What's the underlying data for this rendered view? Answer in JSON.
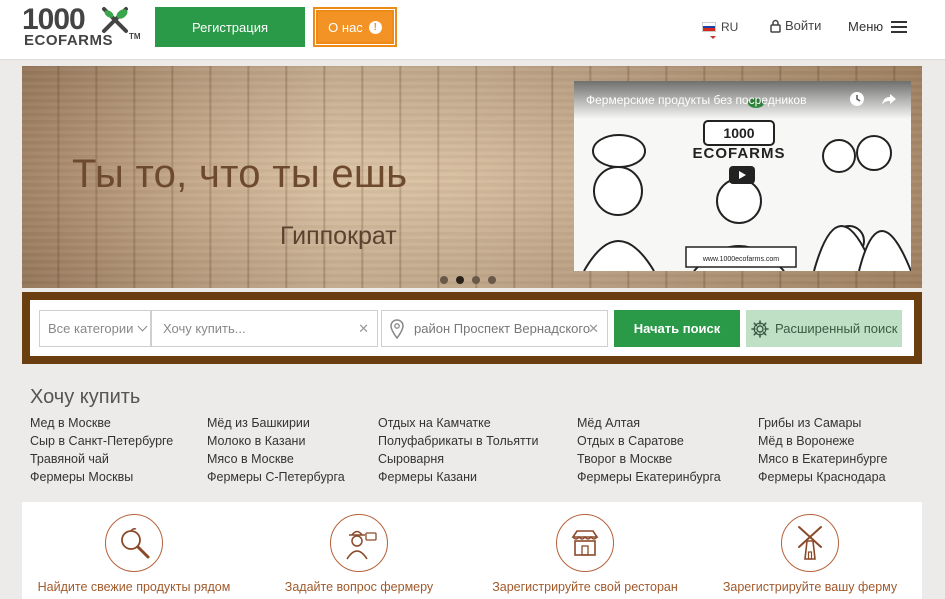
{
  "header": {
    "logo_num": "1000",
    "logo_text": "ECOFARMS",
    "logo_tm": "TM",
    "register_label": "Регистрация",
    "about_label": "О нас",
    "lang": "RU",
    "login_label": "Войти",
    "menu_label": "Меню"
  },
  "hero": {
    "quote": "Ты то, что ты ешь",
    "author": "Гиппократ",
    "video_title": "Фермерские продукты без посредников",
    "slides_total": 4,
    "slide_active": 2
  },
  "search": {
    "category_label": "Все категории",
    "buy_placeholder": "Хочу купить...",
    "location_value": "район Проспект Вернадского",
    "search_button": "Начать поиск",
    "advanced_button": "Расширенный поиск"
  },
  "want": {
    "title": "Хочу купить",
    "columns": [
      [
        "Мед в Москве",
        "Сыр в Санкт-Петербурге",
        "Травяной чай",
        "Фермеры Москвы"
      ],
      [
        "Мёд из Башкирии",
        "Молоко в Казани",
        "Мясо в Москве",
        "Фермеры С-Петербурга"
      ],
      [
        "Отдых на Камчатке",
        "Полуфабрикаты в Тольятти",
        "Сыроварня",
        "Фермеры Казани"
      ],
      [
        "Мёд Алтая",
        "Отдых в Саратове",
        "Творог в Москве",
        "Фермеры Екатеринбурга"
      ],
      [
        "Грибы из Самары",
        "Мёд в Воронеже",
        "Мясо в Екатеринбурге",
        "Фермеры Краснодара"
      ]
    ]
  },
  "features": [
    {
      "label": "Найдите свежие продукты рядом",
      "icon": "magnifier-apple-icon"
    },
    {
      "label": "Задайте вопрос фермеру",
      "icon": "farmer-icon"
    },
    {
      "label": "Зарегистрируйте свой ресторан",
      "icon": "restaurant-icon"
    },
    {
      "label": "Зарегистрируйте вашу ферму",
      "icon": "windmill-icon"
    }
  ],
  "colors": {
    "green": "#2a9a48",
    "orange": "#f39325",
    "brown_frame": "#6b3e12",
    "icon_brown": "#b5623a"
  }
}
